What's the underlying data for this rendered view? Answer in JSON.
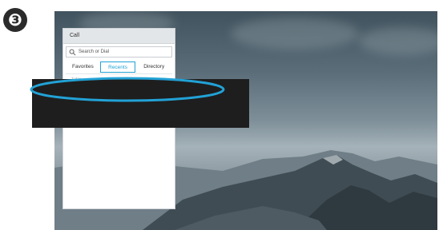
{
  "step": {
    "number": "❸"
  },
  "call_panel": {
    "title": "Call",
    "search": {
      "placeholder": "Search or Dial",
      "icon": "search-icon"
    },
    "tabs": [
      {
        "label": "Favorites",
        "selected": false
      },
      {
        "label": "Recents",
        "selected": true
      },
      {
        "label": "Directory",
        "selected": false
      }
    ],
    "section_label": "Today"
  },
  "annotation": {
    "shape": "ellipse",
    "color": "#22a2d6"
  },
  "redaction": {
    "color": "#1e1e1e"
  }
}
